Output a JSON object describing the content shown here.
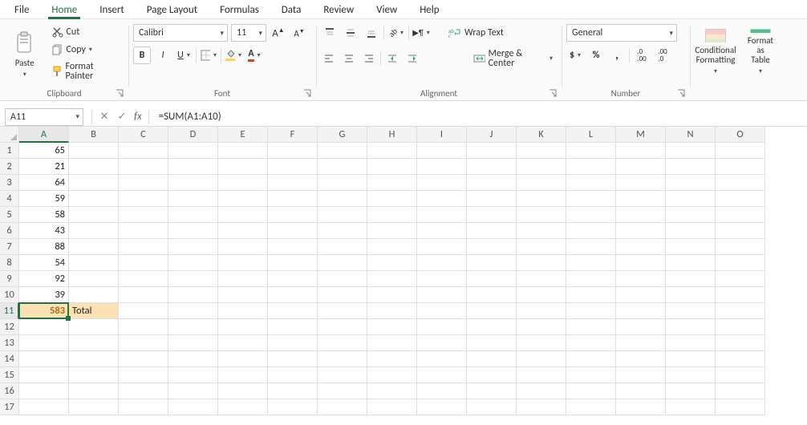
{
  "menu": [
    "File",
    "Home",
    "Insert",
    "Page Layout",
    "Formulas",
    "Data",
    "Review",
    "View",
    "Help"
  ],
  "menu_active": "Home",
  "ribbon": {
    "clipboard": {
      "paste": "Paste",
      "cut": "Cut",
      "copy": "Copy",
      "painter": "Format Painter",
      "group": "Clipboard"
    },
    "font": {
      "font_name": "Calibri",
      "font_size": "11",
      "group": "Font"
    },
    "alignment": {
      "wrap": "Wrap Text",
      "merge": "Merge & Center",
      "group": "Alignment"
    },
    "number": {
      "format": "General",
      "group": "Number"
    },
    "styles": {
      "conditional": "Conditional\nFormatting",
      "format_table": "Format as\nTable"
    }
  },
  "namebox": "A11",
  "formula": "=SUM(A1:A10)",
  "columns": [
    "A",
    "B",
    "C",
    "D",
    "E",
    "F",
    "G",
    "H",
    "I",
    "J",
    "K",
    "L",
    "M",
    "N",
    "O"
  ],
  "rows": 17,
  "selected_col": "A",
  "selected_row": 11,
  "cells": {
    "A1": "65",
    "A2": "21",
    "A3": "64",
    "A4": "59",
    "A5": "58",
    "A6": "43",
    "A7": "88",
    "A8": "54",
    "A9": "92",
    "A10": "39",
    "A11": "583",
    "B11": "Total"
  },
  "highlight": [
    "A11",
    "B11"
  ]
}
